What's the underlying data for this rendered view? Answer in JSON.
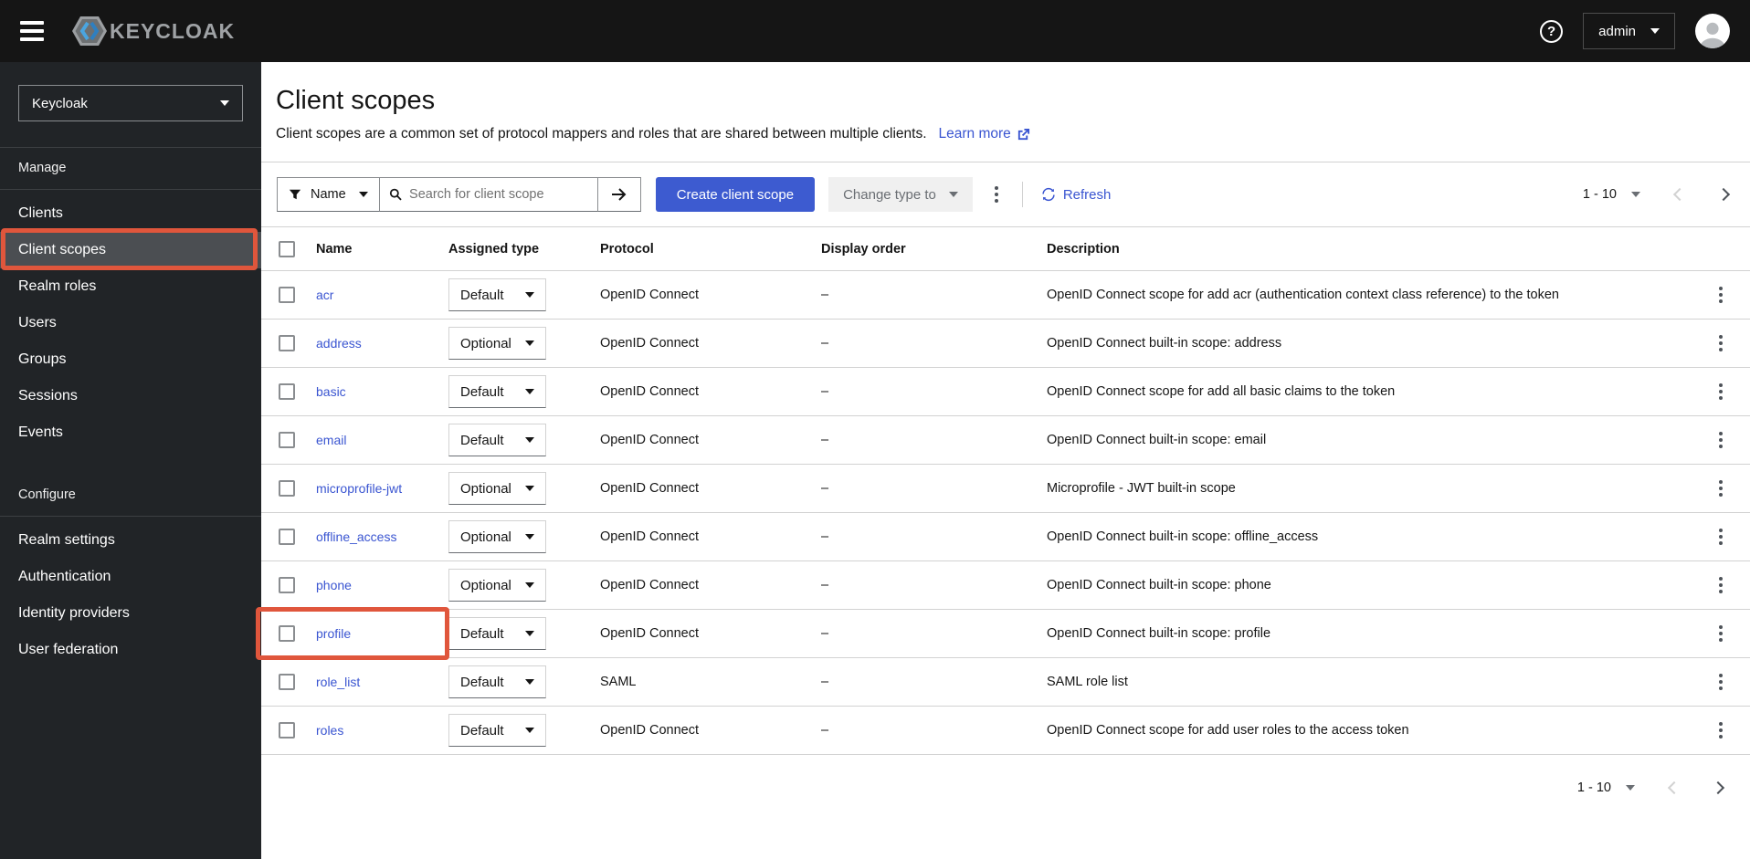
{
  "masthead": {
    "brand": "KEYCLOAK",
    "help_icon": "?",
    "user_menu": {
      "label": "admin"
    }
  },
  "sidebar": {
    "realm_selector": "Keycloak",
    "selected_item": "Client scopes",
    "sections": [
      {
        "label": "Manage",
        "items": [
          "Clients",
          "Client scopes",
          "Realm roles",
          "Users",
          "Groups",
          "Sessions",
          "Events"
        ]
      },
      {
        "label": "Configure",
        "items": [
          "Realm settings",
          "Authentication",
          "Identity providers",
          "User federation"
        ]
      }
    ]
  },
  "page": {
    "title": "Client scopes",
    "description": "Client scopes are a common set of protocol mappers and roles that are shared between multiple clients.",
    "learn_more": "Learn more"
  },
  "toolbar": {
    "filter_label": "Name",
    "search_placeholder": "Search for client scope",
    "create_button": "Create client scope",
    "change_type_label": "Change type to",
    "refresh_label": "Refresh",
    "pagination": "1 - 10"
  },
  "table": {
    "columns": [
      "Name",
      "Assigned type",
      "Protocol",
      "Display order",
      "Description"
    ],
    "rows": [
      {
        "name": "acr",
        "type": "Default",
        "protocol": "OpenID Connect",
        "display_order": "–",
        "description": "OpenID Connect scope for add acr (authentication context class reference) to the token"
      },
      {
        "name": "address",
        "type": "Optional",
        "protocol": "OpenID Connect",
        "display_order": "–",
        "description": "OpenID Connect built-in scope: address"
      },
      {
        "name": "basic",
        "type": "Default",
        "protocol": "OpenID Connect",
        "display_order": "–",
        "description": "OpenID Connect scope for add all basic claims to the token"
      },
      {
        "name": "email",
        "type": "Default",
        "protocol": "OpenID Connect",
        "display_order": "–",
        "description": "OpenID Connect built-in scope: email"
      },
      {
        "name": "microprofile-jwt",
        "type": "Optional",
        "protocol": "OpenID Connect",
        "display_order": "–",
        "description": "Microprofile - JWT built-in scope"
      },
      {
        "name": "offline_access",
        "type": "Optional",
        "protocol": "OpenID Connect",
        "display_order": "–",
        "description": "OpenID Connect built-in scope: offline_access"
      },
      {
        "name": "phone",
        "type": "Optional",
        "protocol": "OpenID Connect",
        "display_order": "–",
        "description": "OpenID Connect built-in scope: phone"
      },
      {
        "name": "profile",
        "type": "Default",
        "protocol": "OpenID Connect",
        "display_order": "–",
        "description": "OpenID Connect built-in scope: profile",
        "highlighted": true
      },
      {
        "name": "role_list",
        "type": "Default",
        "protocol": "SAML",
        "display_order": "–",
        "description": "SAML role list"
      },
      {
        "name": "roles",
        "type": "Default",
        "protocol": "OpenID Connect",
        "display_order": "–",
        "description": "OpenID Connect scope for add user roles to the access token"
      }
    ],
    "pagination": "1 - 10"
  },
  "annotations": {
    "highlight_color": "#e0563c",
    "highlighted_nav_item": "Client scopes",
    "highlighted_row": "profile"
  },
  "colors": {
    "masthead_bg": "#151515",
    "sidebar_bg": "#212427",
    "selected_nav_bg": "#4b4e52",
    "primary_blue": "#3d5bd0",
    "link_blue": "#3a55d1",
    "annotation_red": "#e0563c"
  }
}
